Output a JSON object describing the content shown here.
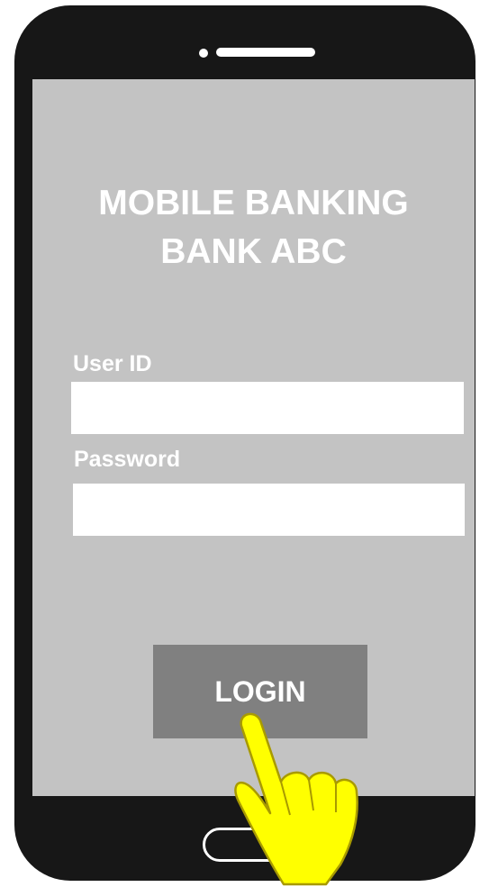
{
  "app": {
    "title_line1": "MOBILE BANKING",
    "title_line2": "BANK ABC"
  },
  "form": {
    "user_id_label": "User ID",
    "user_id_value": "",
    "password_label": "Password",
    "password_value": "",
    "login_label": "LOGIN"
  },
  "colors": {
    "phone_body": "#171717",
    "screen": "#c3c3c3",
    "button": "#808080",
    "pointer": "#ffff00"
  },
  "icons": {
    "pointer": "pointing-hand-icon",
    "home": "home-button",
    "speaker": "speaker-icon"
  }
}
